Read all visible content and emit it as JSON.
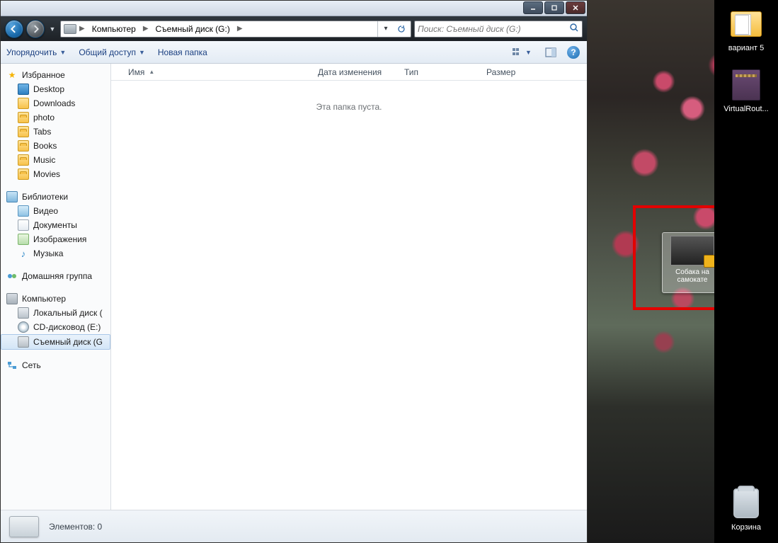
{
  "window": {
    "titlebar": {
      "min": "—",
      "max": "▢",
      "close": "✕"
    },
    "nav": {
      "back_icon": "arrow-left",
      "fwd_icon": "arrow-right",
      "breadcrumb": {
        "drive_icon": "drive-icon",
        "seg1": "Компьютер",
        "seg2": "Съемный диск (G:)"
      },
      "addr_dropdown_icon": "chevron-down",
      "addr_refresh_icon": "refresh",
      "search_placeholder": "Поиск: Съемный диск (G:)",
      "search_icon": "magnifier"
    },
    "toolbar": {
      "organize": "Упорядочить",
      "share": "Общий доступ",
      "new_folder": "Новая папка",
      "view_icon": "view-options",
      "preview_icon": "preview-pane",
      "help_icon": "help"
    },
    "columns": {
      "name": "Имя",
      "date": "Дата изменения",
      "type": "Тип",
      "size": "Размер"
    },
    "empty_message": "Эта папка пуста.",
    "status": {
      "label": "Элементов: 0"
    }
  },
  "sidebar": {
    "favorites": {
      "head": "Избранное",
      "items": [
        "Desktop",
        "Downloads",
        "photo",
        "Tabs",
        "Books",
        "Music",
        "Movies"
      ]
    },
    "libraries": {
      "head": "Библиотеки",
      "items": [
        "Видео",
        "Документы",
        "Изображения",
        "Музыка"
      ]
    },
    "homegroup": {
      "head": "Домашняя группа"
    },
    "computer": {
      "head": "Компьютер",
      "items": [
        "Локальный диск (",
        "CD-дисковод (E:)",
        "Съемный диск (G"
      ]
    },
    "network": {
      "head": "Сеть"
    }
  },
  "desktop": {
    "icons": {
      "folder": "вариант 5",
      "rar": "VirtualRout...",
      "recycle": "Корзина"
    },
    "dragged_file": {
      "label_l1": "Собака на",
      "label_l2": "самокате"
    }
  }
}
